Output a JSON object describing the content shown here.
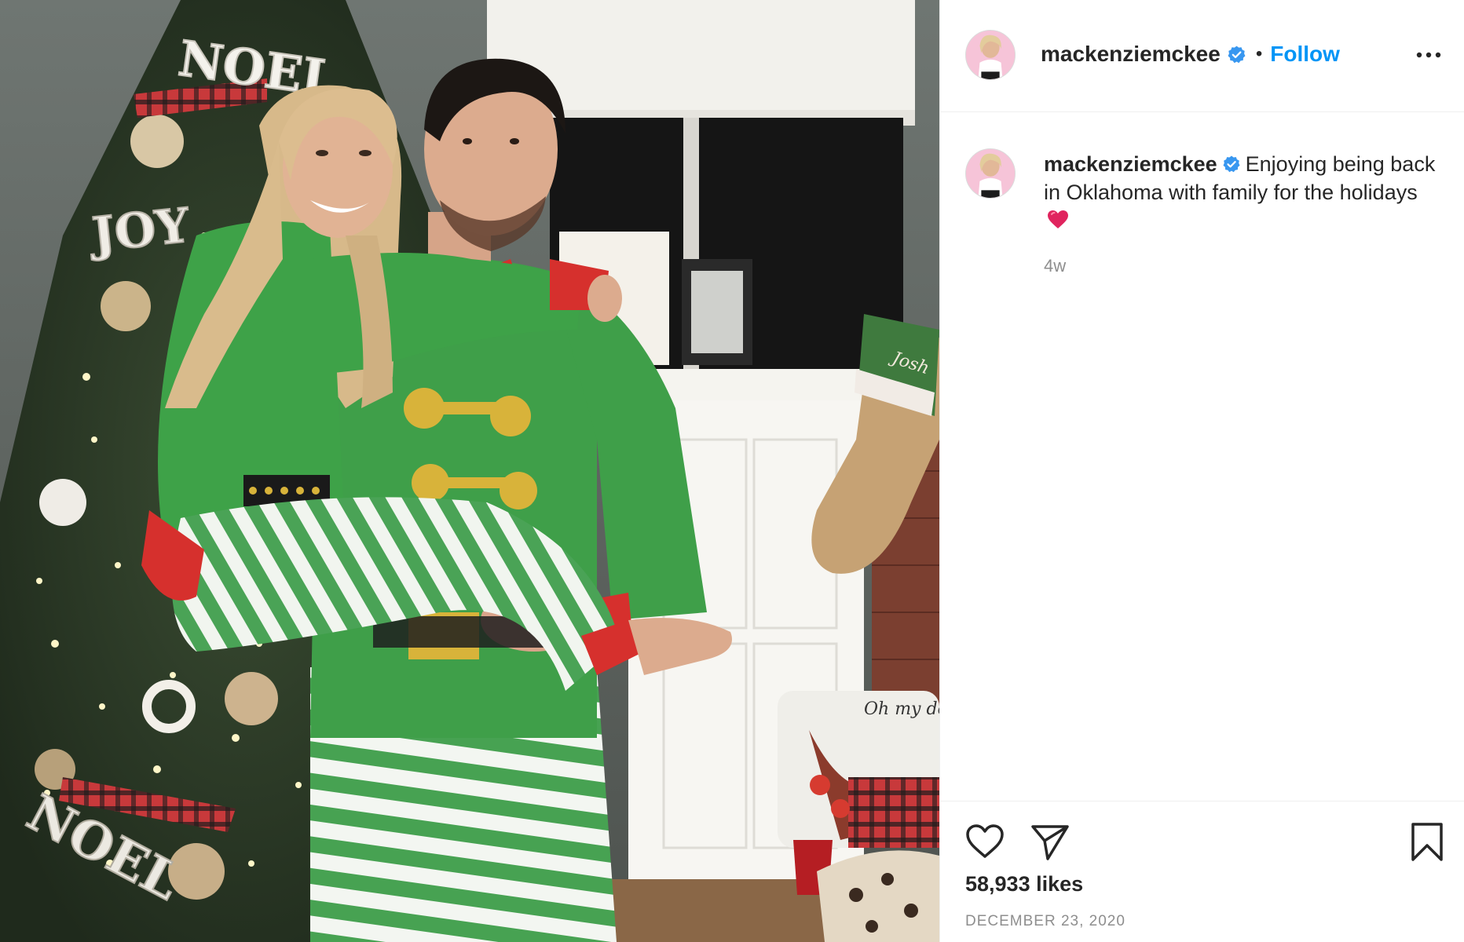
{
  "post": {
    "username": "mackenziemckee",
    "separator": "•",
    "follow_label": "Follow",
    "caption_text": "Enjoying being back in Oklahoma with family for the holidays",
    "caption_emoji": "red-heart",
    "time_ago": "4w",
    "likes": "58,933 likes",
    "date": "DECEMBER 23, 2020"
  },
  "photo": {
    "stocking_name": "Josh",
    "pillow_text": "Oh my deer",
    "tree_signs": [
      "NOEL",
      "JOY",
      "NOEL"
    ]
  },
  "icons": {
    "verified": "verified-badge-icon",
    "more": "more-options-icon",
    "like": "heart-outline-icon",
    "share": "paper-plane-icon",
    "save": "bookmark-icon"
  },
  "colors": {
    "accent": "#0095f6",
    "text": "#262626",
    "muted": "#8e8e8e",
    "divider": "#efefef",
    "pajama_green": "#3fa14a"
  }
}
